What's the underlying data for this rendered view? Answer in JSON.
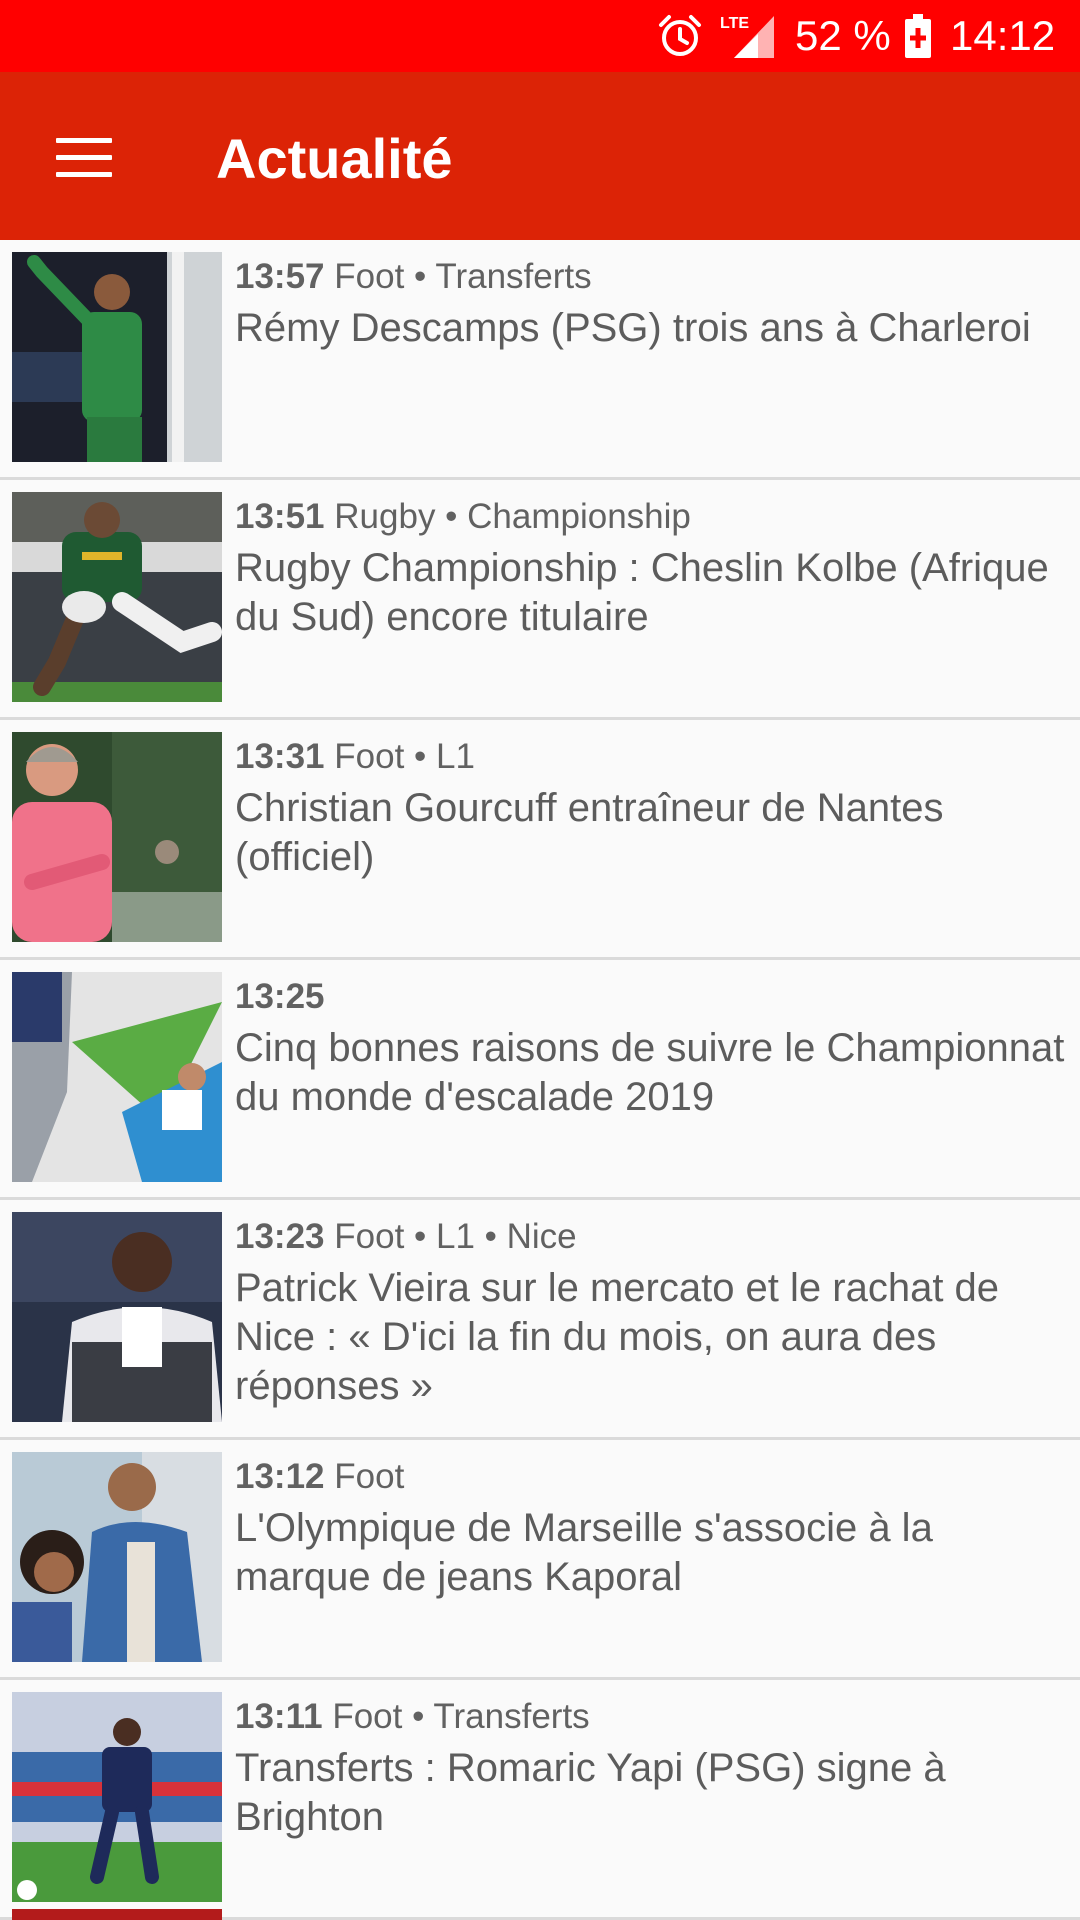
{
  "status_bar": {
    "battery": "52 %",
    "time": "14:12",
    "network": "LTE"
  },
  "app_bar": {
    "title": "Actualité",
    "menu_icon": "hamburger-menu-icon"
  },
  "colors": {
    "status_bar": "#ff0000",
    "app_bar": "#dc2306",
    "background": "#fafafa"
  },
  "feed": [
    {
      "time": "13:57",
      "category": "Foot • Transferts",
      "headline": "Rémy Descamps (PSG) trois ans à Charleroi"
    },
    {
      "time": "13:51",
      "category": "Rugby • Championship",
      "headline": "Rugby Championship : Cheslin Kolbe (Afrique du Sud) encore titulaire"
    },
    {
      "time": "13:31",
      "category": "Foot • L1",
      "headline": "Christian Gourcuff entraîneur de Nantes (officiel)"
    },
    {
      "time": "13:25",
      "category": "",
      "headline": "Cinq bonnes raisons de suivre le Championnat du monde d'escalade 2019"
    },
    {
      "time": "13:23",
      "category": "Foot • L1 • Nice",
      "headline": "Patrick Vieira sur le mercato et le rachat de Nice : « D'ici la fin du mois, on aura des réponses »"
    },
    {
      "time": "13:12",
      "category": "Foot",
      "headline": "L'Olympique de Marseille s'associe à la marque de jeans Kaporal"
    },
    {
      "time": "13:11",
      "category": "Foot • Transferts",
      "headline": "Transferts : Romaric Yapi (PSG) signe à Brighton"
    }
  ]
}
